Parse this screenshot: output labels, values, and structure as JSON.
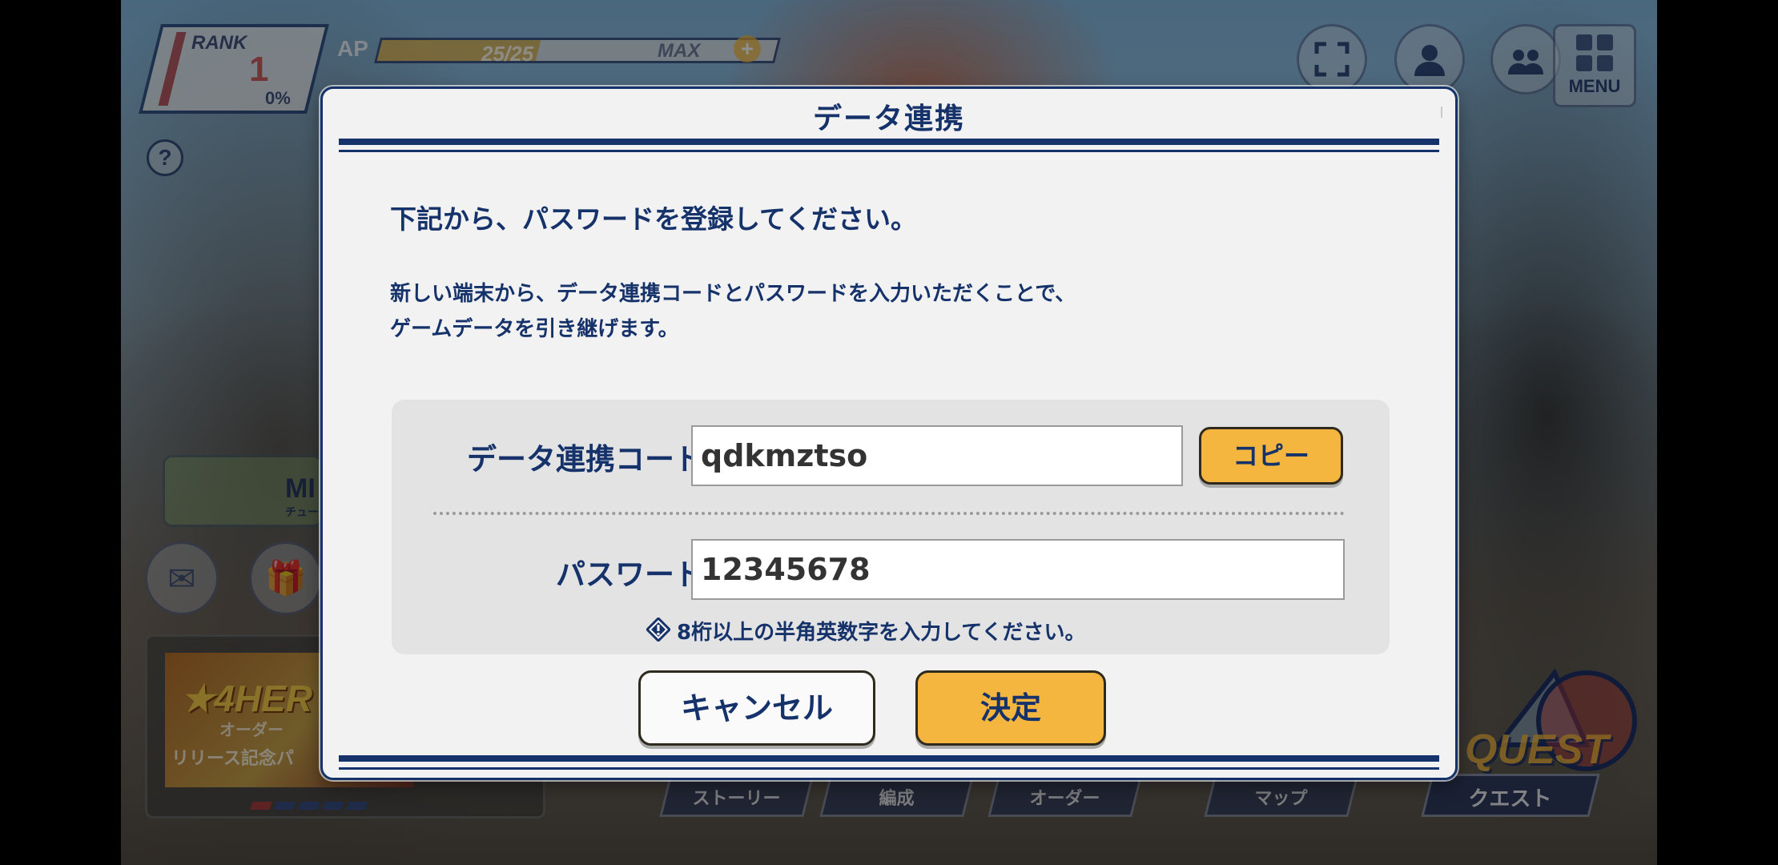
{
  "hud": {
    "rank_label": "RANK",
    "rank_value": "1",
    "rank_percent": "0%",
    "ap_label": "AP",
    "ap_value": "25/25",
    "ap_fill": 0.4,
    "ap_max": "MAX",
    "ap_plus": "+",
    "help": "?",
    "menu_label": "MENU"
  },
  "background": {
    "mission_label": "MI",
    "mission_sub": "チュー",
    "banner_title": "★4HER",
    "banner_sub": "オーダー",
    "banner_bottom": "リリース記念パ",
    "nav": [
      "ストーリー",
      "編成",
      "オーダー",
      "マップ"
    ],
    "quest_logo": "QUEST",
    "quest_tab": "クエスト"
  },
  "dialog": {
    "title": "データ連携",
    "lead": "下記から、パスワードを登録してください。",
    "desc_line1": "新しい端末から、データ連携コードとパスワードを入力いただくことで、",
    "desc_line2": "ゲームデータを引き継げます。",
    "code_label": "データ連携コード",
    "code_value": "qdkmztso",
    "copy_button": "コピー",
    "password_label": "パスワード",
    "password_value": "12345678",
    "hint": "8桁以上の半角英数字を入力してください。",
    "cancel_button": "キャンセル",
    "ok_button": "決定"
  },
  "colors": {
    "navy": "#15326a",
    "accent": "#f4b63f",
    "dialog_bg": "#f2f2f2",
    "panel_bg": "#e3e3e3"
  },
  "icons": [
    "fullscreen-icon",
    "profile-icon",
    "friends-icon",
    "menu-grid-icon",
    "mail-icon",
    "gift-icon",
    "warning-diamond-icon"
  ]
}
